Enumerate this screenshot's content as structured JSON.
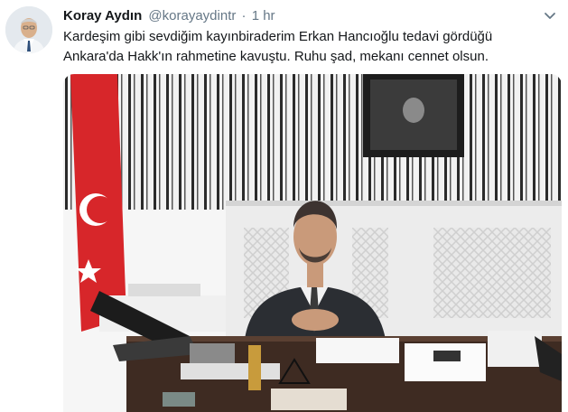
{
  "tweet": {
    "display_name": "Koray Aydın",
    "handle": "@korayaydintr",
    "separator": "·",
    "time": "1 hr",
    "text_lines": [
      "Kardeşim gibi sevdiğim kayınbiraderim Erkan Hancıoğlu tedavi gördüğü",
      "Ankara'da Hakk'ın rahmetine kavuştu. Ruhu şad, mekanı cennet olsun."
    ]
  },
  "icons": {
    "caret": "chevron-down-icon"
  },
  "colors": {
    "name": "#14171a",
    "secondary_text": "#657786",
    "background": "#ffffff"
  }
}
